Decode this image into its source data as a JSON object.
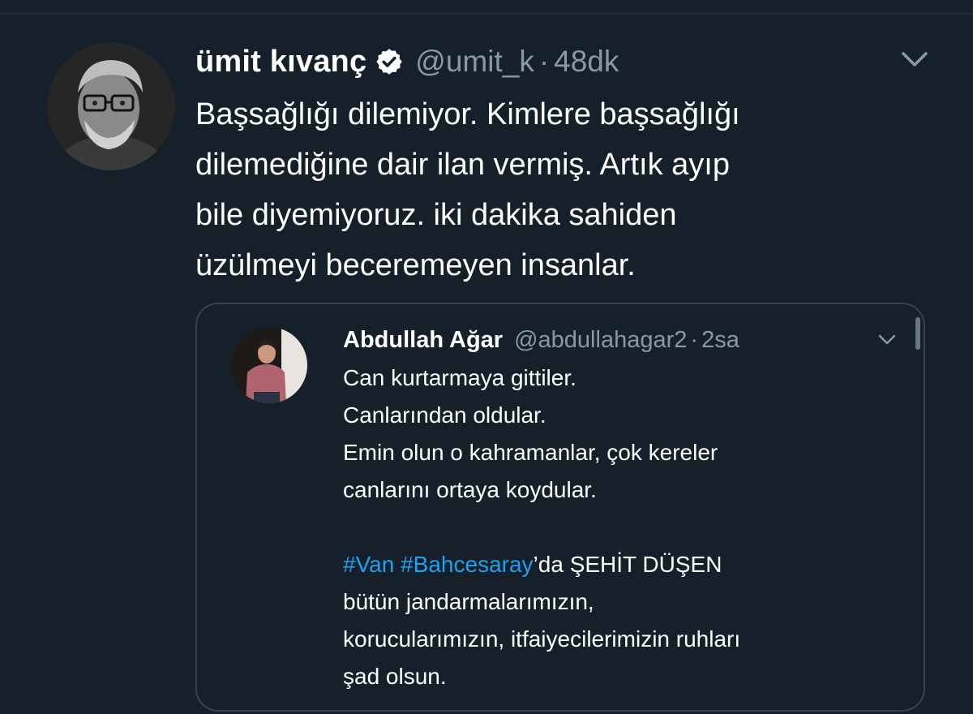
{
  "tweet": {
    "author_name": "ümit kıvanç",
    "handle": "@umit_k",
    "separator": "·",
    "time": "48dk",
    "verified_icon": "verified-badge-icon",
    "menu_icon": "chevron-down-icon",
    "text_lines": [
      "Başsağlığı dilemiyor. Kimlere başsağlığı",
      "dilemediğine dair ilan vermiş. Artık ayıp",
      "bile diyemiyoruz. iki dakika sahiden",
      "üzülmeyi beceremeyen insanlar."
    ]
  },
  "quoted": {
    "author_name": "Abdullah Ağar",
    "handle": "@abdullahagar2",
    "separator": "·",
    "time": "2sa",
    "menu_icon": "chevron-down-icon",
    "lines": [
      "Can kurtarmaya gittiler.",
      "Canlarından oldular.",
      "Emin olun o kahramanlar, çok kereler",
      "canlarını ortaya koydular."
    ],
    "hashtag_1": "#Van",
    "hashtag_2": "#Bahcesaray",
    "hashtag_suffix": "’da ŞEHİT DÜŞEN",
    "lines_after": [
      "bütün jandarmalarımızın,",
      "korucularımızın, itfaiyecilerimizin ruhları",
      "şad olsun."
    ]
  },
  "colors": {
    "background": "#15202b",
    "border": "#38444d",
    "secondary_text": "#8899a6",
    "link": "#1da1f2",
    "verified_badge": "#ffffff"
  }
}
